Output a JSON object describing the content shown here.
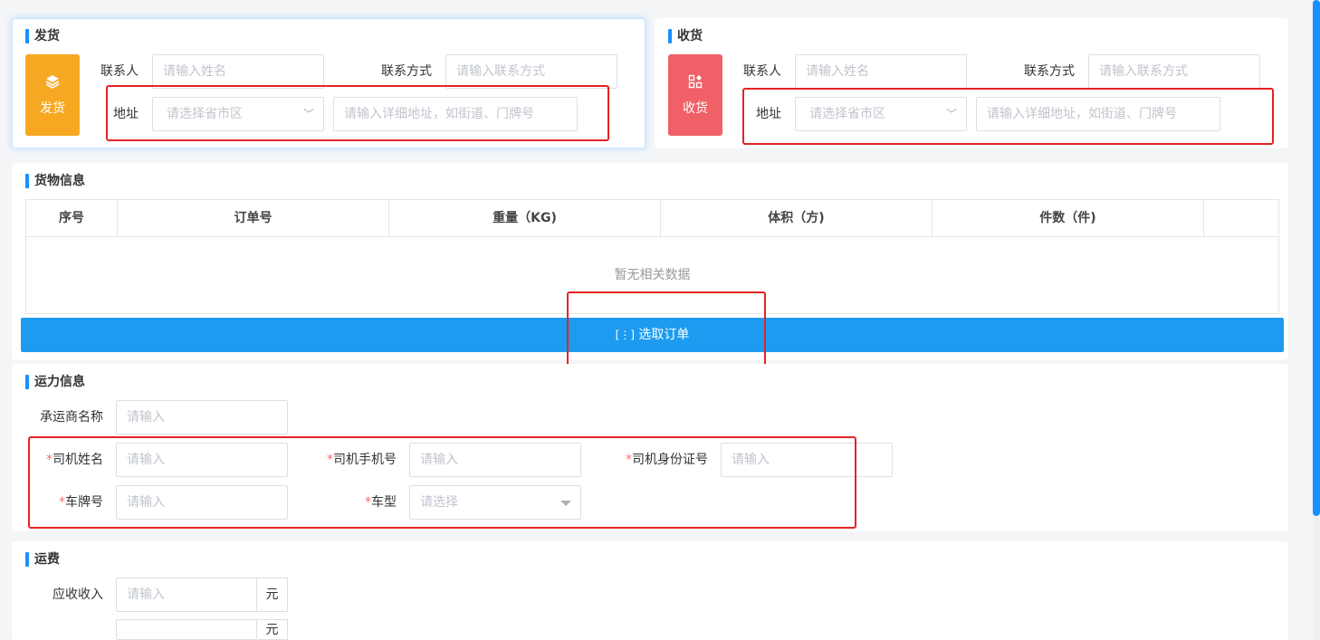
{
  "ship": {
    "title": "发货",
    "icon_label": "发货",
    "icon_color": "#f7a823",
    "contact_label": "联系人",
    "contact_placeholder": "请输入姓名",
    "phone_label": "联系方式",
    "phone_placeholder": "请输入联系方式",
    "address_label": "地址",
    "region_placeholder": "请选择省市区",
    "detail_placeholder": "请输入详细地址，如街道、门牌号"
  },
  "receive": {
    "title": "收货",
    "icon_label": "收货",
    "icon_color": "#f06066",
    "contact_label": "联系人",
    "contact_placeholder": "请输入姓名",
    "phone_label": "联系方式",
    "phone_placeholder": "请输入联系方式",
    "address_label": "地址",
    "region_placeholder": "请选择省市区",
    "detail_placeholder": "请输入详细地址，如街道、门牌号"
  },
  "goods": {
    "title": "货物信息",
    "columns": [
      "序号",
      "订单号",
      "重量（KG)",
      "体积（方)",
      "件数（件)",
      ""
    ],
    "empty_text": "暂无相关数据",
    "select_button": "选取订单"
  },
  "transport": {
    "title": "运力信息",
    "carrier_label": "承运商名称",
    "carrier_placeholder": "请输入",
    "driver_name_label": "司机姓名",
    "driver_name_placeholder": "请输入",
    "driver_phone_label": "司机手机号",
    "driver_phone_placeholder": "请输入",
    "driver_id_label": "司机身份证号",
    "driver_id_placeholder": "请输入",
    "plate_label": "车牌号",
    "plate_placeholder": "请输入",
    "vehicle_type_label": "车型",
    "vehicle_type_placeholder": "请选择",
    "required_mark": "*"
  },
  "freight": {
    "title": "运费",
    "receivable_label": "应收收入",
    "receivable_placeholder": "请输入",
    "unit": "元"
  },
  "colors": {
    "accent": "#1890ff",
    "button": "#1d9bf0",
    "annotation": "#e52323"
  }
}
